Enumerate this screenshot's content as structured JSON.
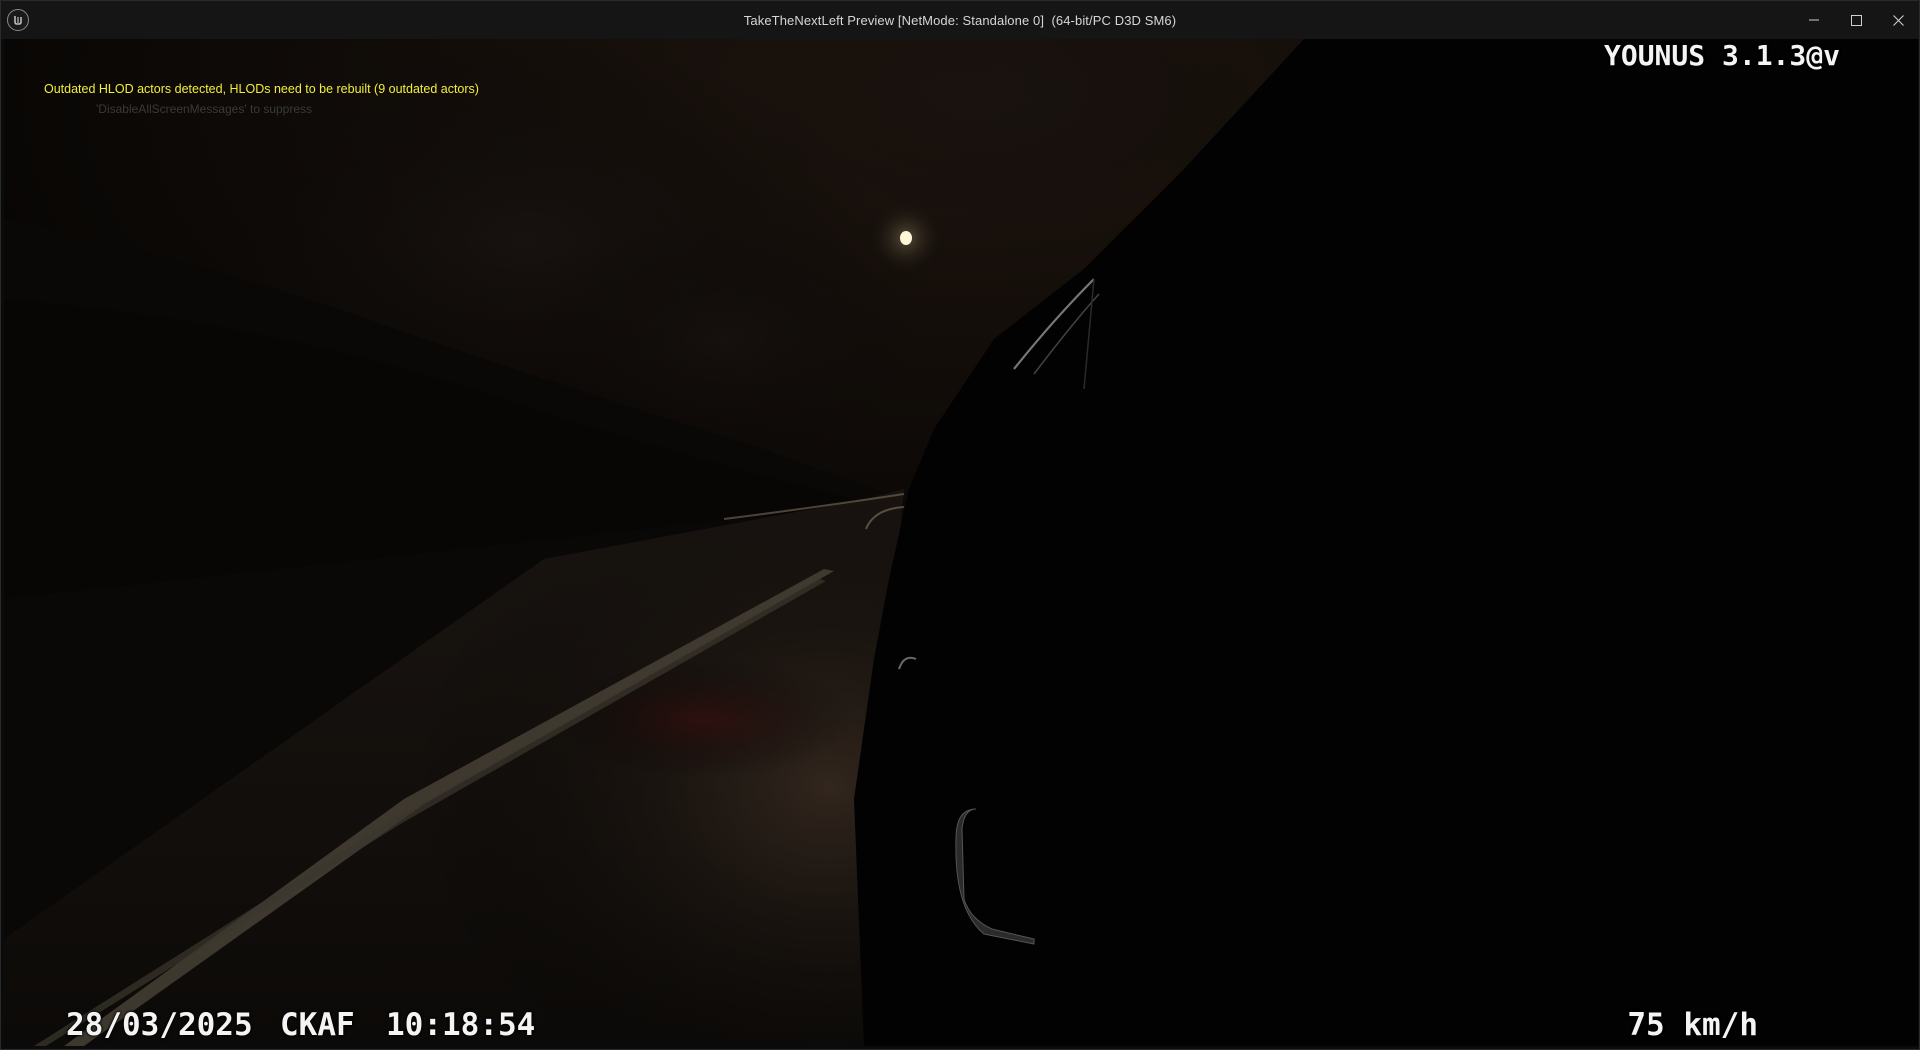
{
  "window": {
    "title": "TakeTheNextLeft Preview [NetMode: Standalone 0]  (64-bit/PC D3D SM6)",
    "controls": [
      {
        "name": "minimize",
        "icon": "minimize-icon"
      },
      {
        "name": "maximize",
        "icon": "maximize-icon"
      },
      {
        "name": "close",
        "icon": "close-icon"
      }
    ],
    "app_icon": "unreal-engine-logo-icon"
  },
  "messages": {
    "hlod_warning": "Outdated HLOD actors detected, HLODs need to be rebuilt (9 outdated actors)",
    "hlod_hint": "'DisableAllScreenMessages' to suppress"
  },
  "hud": {
    "watermark": "YOUNUS 3.1.3@v",
    "date": "28/03/2025",
    "code": "CKAF",
    "time": "10:18:54",
    "speed": "75 km/h"
  },
  "colors": {
    "warning_text": "#f2ef3a",
    "hud_text": "#f4f4f4",
    "title_bar": "#151515"
  }
}
